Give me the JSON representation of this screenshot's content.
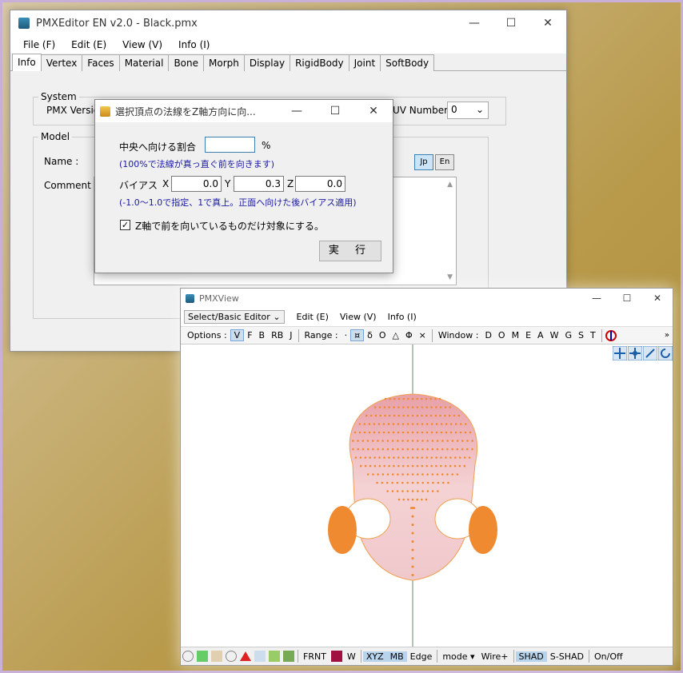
{
  "editor": {
    "title": "PMXEditor EN v2.0 - Black.pmx",
    "menu": [
      "File (F)",
      "Edit (E)",
      "View (V)",
      "Info (I)"
    ],
    "tabs": [
      "Info",
      "Vertex",
      "Faces",
      "Material",
      "Bone",
      "Morph",
      "Display",
      "RigidBody",
      "Joint",
      "SoftBody"
    ],
    "system_group": "System",
    "pmx_version_label": "PMX Versio",
    "uv_number_label": "UV Number :",
    "uv_number_value": "0",
    "model_group": "Model",
    "name_label": "Name :",
    "comment_label": "Comment :",
    "lang_jp": "Jp",
    "lang_en": "En"
  },
  "dialog": {
    "title": "選択頂点の法線をZ軸方向に向...",
    "center_ratio_label": "中央へ向ける割合",
    "center_ratio_value": "",
    "percent": "%",
    "note1": "(100%で法線が真っ直ぐ前を向きます)",
    "bias_label": "バイアス",
    "x_label": "X",
    "x_value": "0.0",
    "y_label": "Y",
    "y_value": "0.3",
    "z_label": "Z",
    "z_value": "0.0",
    "note2": "(-1.0～1.0で指定、1で真上。正面へ向けた後バイアス適用)",
    "checkbox_label": "Z軸で前を向いているものだけ対象にする。",
    "checkbox_checked": "✓",
    "execute_label": "実 行"
  },
  "view": {
    "title": "PMXView",
    "mode_dropdown": "Select/Basic Editor",
    "menu": [
      "Edit (E)",
      "View (V)",
      "Info (I)"
    ],
    "options_label": "Options :",
    "options": [
      "V",
      "F",
      "B",
      "RB",
      "J"
    ],
    "range_label": "Range :",
    "range_items": [
      "·",
      "¤",
      "δ",
      "O",
      "△",
      "Φ",
      "×"
    ],
    "window_label": "Window :",
    "window_items": [
      "D",
      "O",
      "M",
      "E",
      "A",
      "W",
      "G",
      "S",
      "T"
    ],
    "more": "»",
    "status": {
      "frnt": "FRNT",
      "w": "W",
      "xyz": "XYZ",
      "mb": "MB",
      "edge": "Edge",
      "mode": "mode ▾",
      "wire": "Wire+",
      "shad": "SHAD",
      "sshad": "S-SHAD",
      "onoff": "On/Off"
    }
  }
}
